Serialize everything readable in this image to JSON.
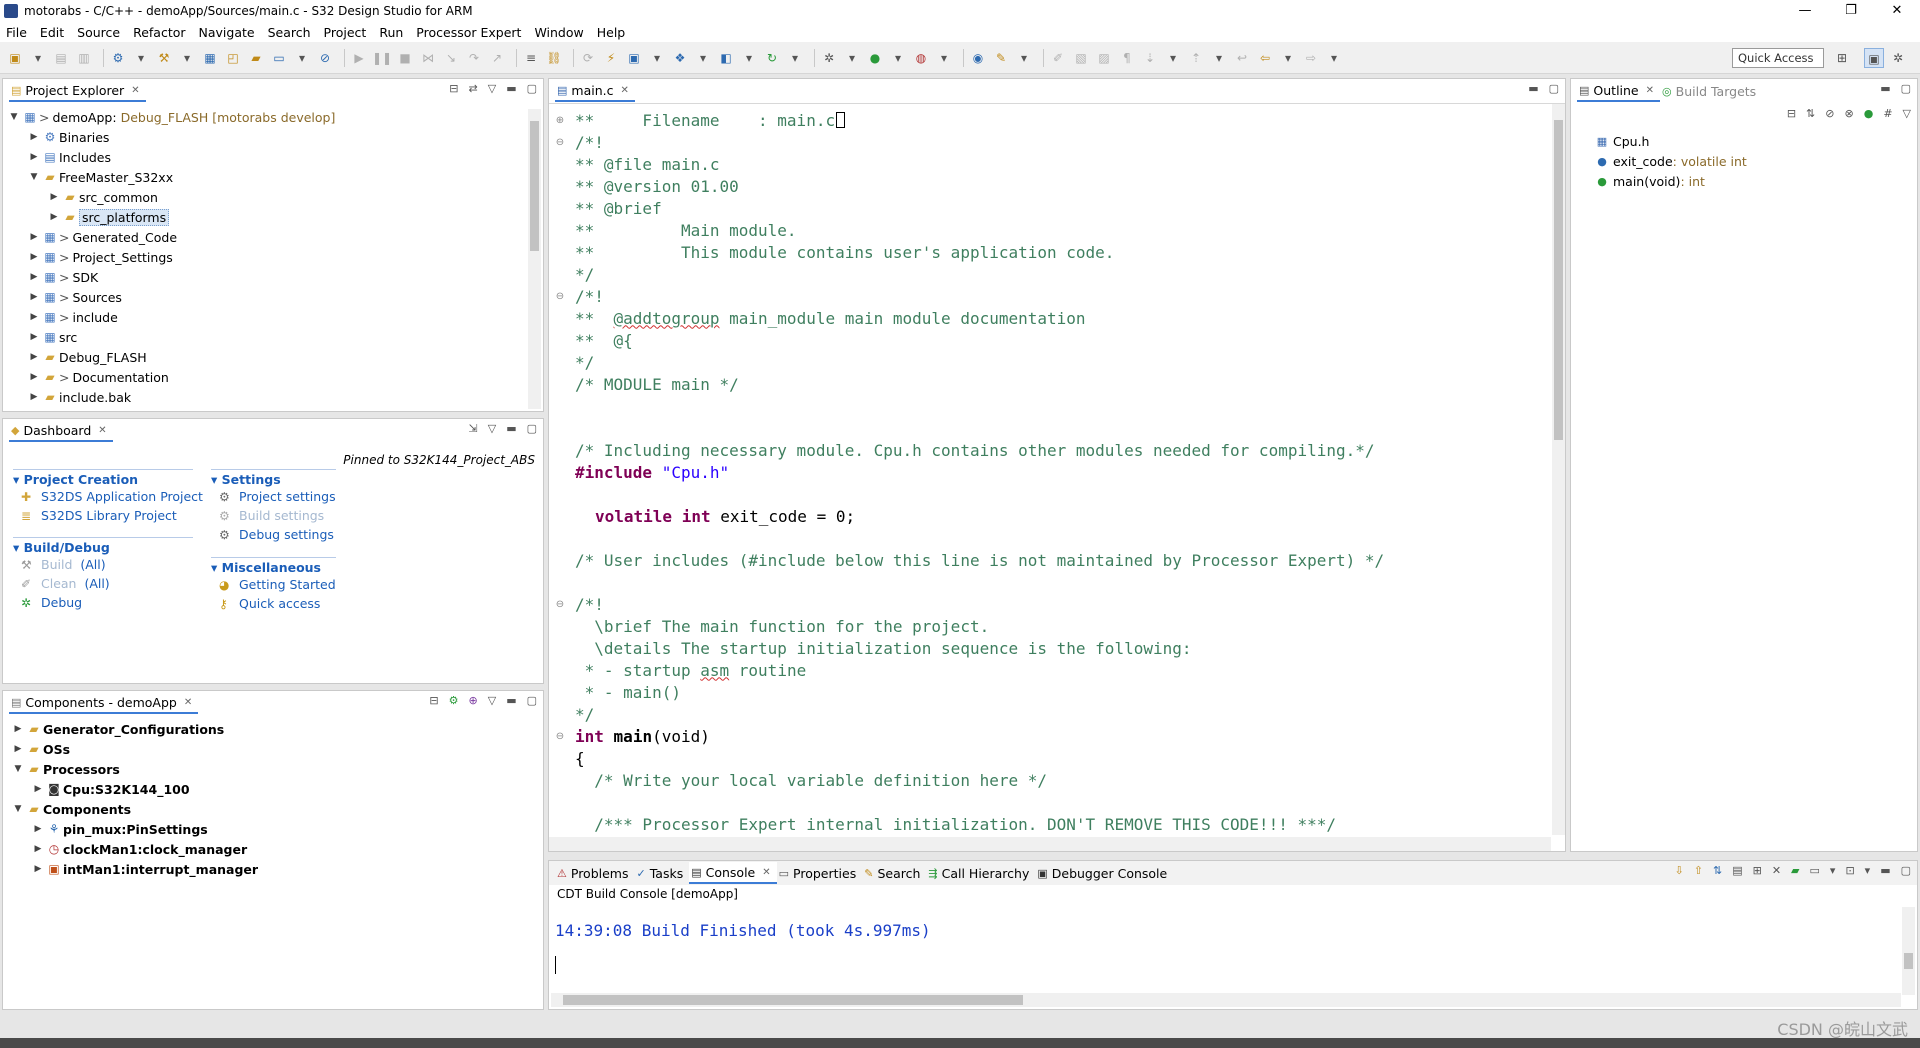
{
  "window": {
    "title": "motorabs - C/C++ - demoApp/Sources/main.c - S32 Design Studio for ARM",
    "controls": [
      "—",
      "❐",
      "✕"
    ]
  },
  "menu": [
    "File",
    "Edit",
    "Source",
    "Refactor",
    "Navigate",
    "Search",
    "Project",
    "Run",
    "Processor Expert",
    "Window",
    "Help"
  ],
  "quick_access": "Quick Access",
  "project_explorer": {
    "tab": "Project Explorer",
    "items": [
      {
        "label": "demoApp",
        "decor": "Debug_FLASH [motorabs develop]",
        "prefix": ">"
      },
      {
        "label": "Binaries"
      },
      {
        "label": "Includes"
      },
      {
        "label": "FreeMaster_S32xx"
      },
      {
        "label": "src_common"
      },
      {
        "label": "src_platforms"
      },
      {
        "label": "Generated_Code",
        "prefix": ">"
      },
      {
        "label": "Project_Settings",
        "prefix": ">"
      },
      {
        "label": "SDK",
        "prefix": ">"
      },
      {
        "label": "Sources",
        "prefix": ">"
      },
      {
        "label": "include",
        "prefix": ">"
      },
      {
        "label": "src"
      },
      {
        "label": "Debug_FLASH"
      },
      {
        "label": "Documentation",
        "prefix": ">"
      },
      {
        "label": "include.bak"
      }
    ]
  },
  "dashboard": {
    "tab": "Dashboard",
    "pinned": "Pinned to S32K144_Project_ABS",
    "sections": {
      "project_creation": {
        "title": "Project Creation",
        "items": [
          "S32DS Application Project",
          "S32DS Library Project"
        ]
      },
      "build_debug": {
        "title": "Build/Debug",
        "items": [
          {
            "label": "Build",
            "extra": "(All)"
          },
          {
            "label": "Clean",
            "extra": "(All)"
          },
          {
            "label": "Debug"
          }
        ]
      },
      "settings": {
        "title": "Settings",
        "items": [
          "Project settings",
          "Build settings",
          "Debug settings"
        ]
      },
      "misc": {
        "title": "Miscellaneous",
        "items": [
          "Getting Started",
          "Quick access"
        ]
      }
    }
  },
  "components": {
    "tab": "Components - demoApp",
    "items": [
      "Generator_Configurations",
      "OSs",
      "Processors",
      "Cpu:S32K144_100",
      "Components",
      "pin_mux:PinSettings",
      "clockMan1:clock_manager",
      "intMan1:interrupt_manager"
    ]
  },
  "editor": {
    "tab": "main.c",
    "lines": [
      "**     Filename    : main.c",
      "/*!",
      "** @file main.c",
      "** @version 01.00",
      "** @brief",
      "**         Main module.",
      "**         This module contains user's application code.",
      "*/",
      "/*!",
      "**  @addtogroup main_module main module documentation",
      "**  @{",
      "*/",
      "/* MODULE main */",
      "",
      "",
      "/* Including necessary module. Cpu.h contains other modules needed for compiling.*/",
      "#include",
      "\"Cpu.h\"",
      "volatile int",
      "exit_code = 0;",
      "/* User includes (#include below this line is not maintained by Processor Expert) */",
      "/*!",
      "  \\brief The main function for the project.",
      "  \\details The startup initialization sequence is the following:",
      " * - startup",
      "asm",
      "routine",
      " * - main()",
      "*/",
      "int",
      "main",
      "(void)",
      "{",
      "  /* Write your local variable definition here */",
      "  /*** Processor Expert internal initialization. DON'T REMOVE THIS CODE!!! ***/",
      "@addtogroup"
    ]
  },
  "outline": {
    "tabs": [
      "Outline",
      "Build Targets"
    ],
    "items": [
      {
        "label": "Cpu.h",
        "type": ""
      },
      {
        "label": "exit_code",
        "type": " : volatile int"
      },
      {
        "label": "main(void)",
        "type": " : int"
      }
    ]
  },
  "bottom": {
    "tabs": [
      "Problems",
      "Tasks",
      "Console",
      "Properties",
      "Search",
      "Call Hierarchy",
      "Debugger Console"
    ],
    "console_title": "CDT Build Console [demoApp]",
    "console_output": "14:39:08 Build Finished (took 4s.997ms)"
  },
  "watermark": "CSDN @皖山文武",
  "colors": {
    "accent": "#3c7cd6",
    "comment": "#3f7f5f",
    "keyword": "#7f0055",
    "string": "#2a00ff",
    "console": "#1a3fc8"
  }
}
